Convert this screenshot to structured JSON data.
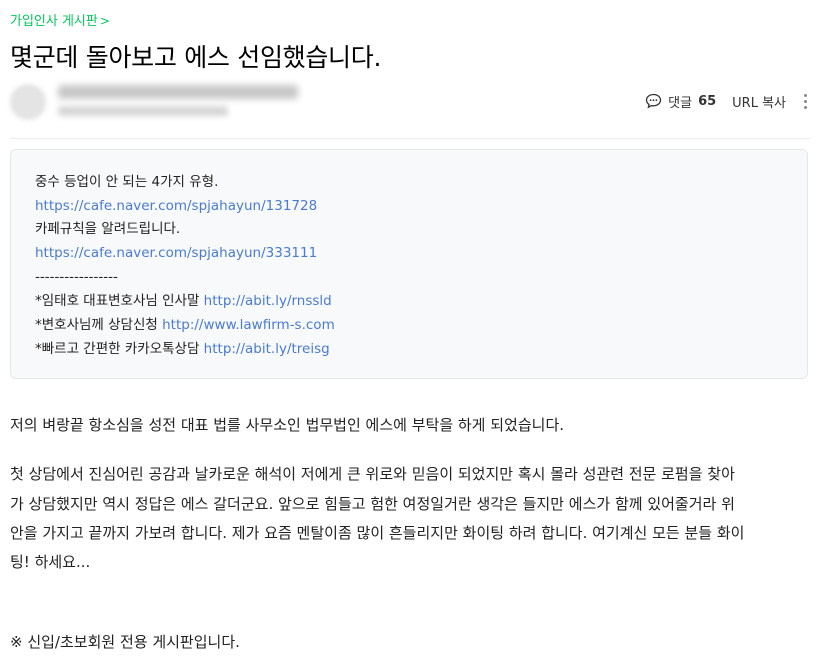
{
  "board": {
    "name": "가입인사 게시판",
    "chevron": ">"
  },
  "post": {
    "title": "몇군데 돌아보고 에스 선임했습니다."
  },
  "tools": {
    "comment_label": "댓글",
    "comment_count": "65",
    "url_copy": "URL 복사",
    "comment_icon": "comment-bubble-icon",
    "more_icon": "more-vertical-icon"
  },
  "notice": {
    "line1": "중수 등업이 안 되는 4가지 유형.",
    "link1": "https://cafe.naver.com/spjahayun/131728",
    "line2": "카페규칙을 알려드립니다.",
    "link2": "https://cafe.naver.com/spjahayun/333111",
    "separator": "-----------------",
    "item1_text": "*임태호 대표변호사님 인사말 ",
    "item1_link": "http://abit.ly/rnssld",
    "item2_text": "*변호사님께 상담신청 ",
    "item2_link": "http://www.lawfirm-s.com",
    "item3_text": "*빠르고 간편한 카카오톡상담 ",
    "item3_link": "http://abit.ly/treisg"
  },
  "content": {
    "para1": "저의 벼랑끝 항소심을 성전 대표 법를 사무소인 법무법인 에스에 부탁을 하게 되었습니다.",
    "para2_lines": [
      "첫 상담에서 진심어린 공감과 날카로운 해석이 저에게 큰 위로와 믿음이 되었지만 혹시 몰라 성관련 전문 로펌을 찾아",
      "가 상담했지만 역시 정답은 에스 갈더군요. 앞으로 힘들고 험한 여정일거란 생각은 들지만 에스가 함께 있어줄거라 위",
      "안을 가지고 끝까지 가보려 합니다. 제가 요즘 멘탈이좀 많이 흔들리지만 화이팅 하려 합니다. 여기계신 모든 분들 화이",
      "팅! 하세요..."
    ],
    "footer_note": "※ 신입/초보회원 전용 게시판입니다."
  }
}
